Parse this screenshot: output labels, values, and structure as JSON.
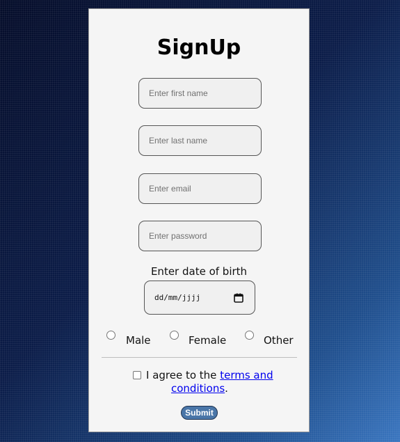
{
  "form": {
    "title": "SignUp",
    "fields": {
      "first_name": {
        "placeholder": "Enter first name",
        "value": ""
      },
      "last_name": {
        "placeholder": "Enter last name",
        "value": ""
      },
      "email": {
        "placeholder": "Enter email",
        "value": ""
      },
      "password": {
        "placeholder": "Enter password",
        "value": ""
      }
    },
    "dob": {
      "label": "Enter date of birth",
      "format_text": "dd/mm/jjjj",
      "icon": "calendar-icon"
    },
    "gender": {
      "options": [
        {
          "label": "Male",
          "checked": false
        },
        {
          "label": "Female",
          "checked": false
        },
        {
          "label": "Other",
          "checked": false
        }
      ]
    },
    "terms": {
      "prefix": "I agree to the",
      "link_line1": "terms and",
      "link_line2": "conditions",
      "suffix": ".",
      "checked": false
    },
    "submit_label": "Submit"
  },
  "colors": {
    "card_bg": "#f5f5f5",
    "submit_bg": "#4a76a8",
    "link": "#0000ee"
  }
}
